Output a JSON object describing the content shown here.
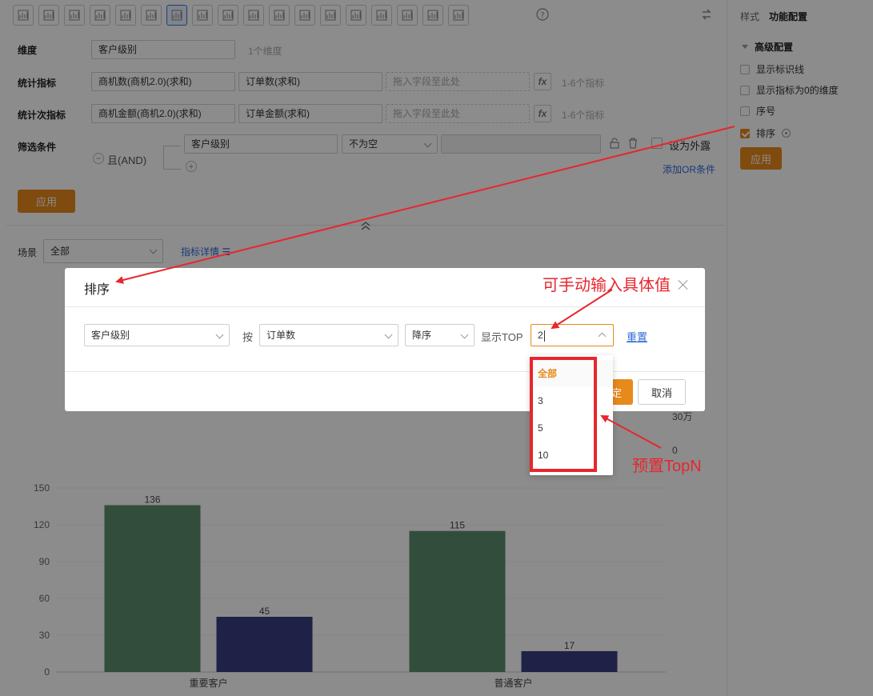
{
  "toolbar": {
    "icons": [
      "bar-chart-icon",
      "line-chart-icon",
      "pie-chart-icon",
      "funnel-icon",
      "funnel-alt-icon",
      "table-icon",
      "combo-chart-icon",
      "card-icon",
      "gauge-icon",
      "radar-icon",
      "map-icon",
      "globe-icon",
      "ring-icon",
      "histogram-icon",
      "area-chart-icon",
      "heatmap-icon",
      "pivot-table-icon",
      "scatter-icon",
      "help-icon"
    ],
    "active_index": 6
  },
  "right_panel": {
    "tabs": [
      "样式",
      "功能配置"
    ],
    "active_tab": "功能配置",
    "section": "高级配置",
    "options": [
      {
        "label": "显示标识线",
        "checked": false
      },
      {
        "label": "显示指标为0的维度",
        "checked": false
      },
      {
        "label": "序号",
        "checked": false
      },
      {
        "label": "排序",
        "checked": true
      }
    ],
    "apply_label": "应用"
  },
  "form": {
    "dimension": {
      "label": "维度",
      "value": "客户级别",
      "hint": "1个维度"
    },
    "metric": {
      "label": "统计指标",
      "values": [
        "商机数(商机2.0)(求和)",
        "订单数(求和)"
      ],
      "placeholder": "拖入字段至此处",
      "hint": "1-6个指标"
    },
    "sub_metric": {
      "label": "统计次指标",
      "values": [
        "商机金额(商机2.0)(求和)",
        "订单金额(求和)"
      ],
      "placeholder": "拖入字段至此处",
      "hint": "1-6个指标"
    },
    "filter": {
      "label": "筛选条件",
      "logic": "且(AND)",
      "field": "客户级别",
      "operator": "不为空",
      "value": "",
      "expose_label": "设为外露",
      "add_or": "添加OR条件"
    },
    "apply_label": "应用",
    "fx": "fx"
  },
  "scene": {
    "label": "场景",
    "value": "全部",
    "detail_link": "指标详情 ☰"
  },
  "modal": {
    "title": "排序",
    "field": "客户级别",
    "by_label": "按",
    "by_field": "订单数",
    "order": "降序",
    "top_label": "显示TOP",
    "top_value": "2",
    "reset": "重置",
    "ok": "定",
    "cancel": "取消"
  },
  "dropdown": {
    "options": [
      "全部",
      "3",
      "5",
      "10"
    ],
    "selected": "全部"
  },
  "behind_labels": {
    "right_axis_top": "30万",
    "right_axis_zero": "0"
  },
  "annotations": {
    "manual_input": "可手动输入具体值",
    "preset": "预置TopN"
  },
  "colors": {
    "accent": "#e8891b",
    "series1": "#5b8c6e",
    "series2": "#3a3c82",
    "annotation": "#e8262d"
  },
  "chart_data": {
    "type": "bar",
    "categories": [
      "重要客户",
      "普通客户"
    ],
    "series": [
      {
        "values": [
          136,
          115
        ],
        "color": "#5b8c6e"
      },
      {
        "values": [
          45,
          17
        ],
        "color": "#3a3c82"
      }
    ],
    "yticks": [
      0,
      30,
      60,
      90,
      120,
      150
    ],
    "ylim": [
      0,
      150
    ],
    "grid": true
  }
}
